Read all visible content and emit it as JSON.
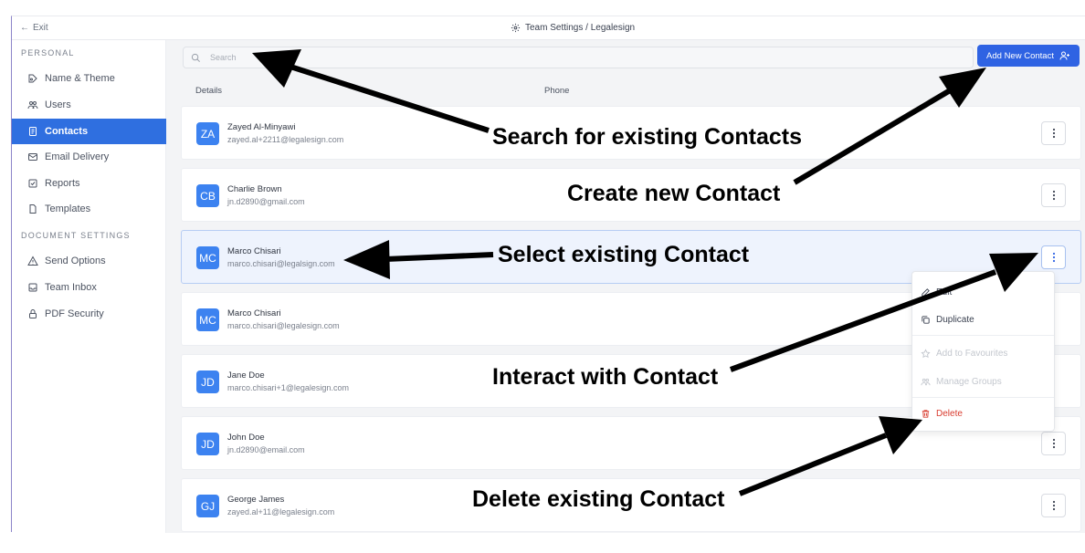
{
  "topbar": {
    "exit_label": "Exit",
    "title": "Team Settings / Legalesign"
  },
  "sidebar": {
    "personal_title": "PERSONAL",
    "document_title": "DOCUMENT SETTINGS",
    "items": [
      {
        "label": "Name & Theme",
        "icon": "brush-icon"
      },
      {
        "label": "Users",
        "icon": "users-icon"
      },
      {
        "label": "Contacts",
        "icon": "contacts-icon",
        "active": true
      },
      {
        "label": "Email Delivery",
        "icon": "mail-icon"
      },
      {
        "label": "Reports",
        "icon": "reports-icon"
      },
      {
        "label": "Templates",
        "icon": "document-icon"
      },
      {
        "label": "Send Options",
        "icon": "warning-icon"
      },
      {
        "label": "Team Inbox",
        "icon": "inbox-icon"
      },
      {
        "label": "PDF Security",
        "icon": "lock-icon"
      }
    ]
  },
  "search": {
    "placeholder": "Search",
    "value": ""
  },
  "add_button": {
    "label": "Add New Contact"
  },
  "columns": {
    "details": "Details",
    "phone": "Phone"
  },
  "contacts": [
    {
      "initials": "ZA",
      "name": "Zayed Al-Minyawi",
      "email": "zayed.al+2211@legalesign.com"
    },
    {
      "initials": "CB",
      "name": "Charlie Brown",
      "email": "jn.d2890@gmail.com"
    },
    {
      "initials": "MC",
      "name": "Marco Chisari",
      "email": "marco.chisari@legalsign.com",
      "selected": true
    },
    {
      "initials": "MC",
      "name": "Marco Chisari",
      "email": "marco.chisari@legalesign.com"
    },
    {
      "initials": "JD",
      "name": "Jane Doe",
      "email": "marco.chisari+1@legalesign.com"
    },
    {
      "initials": "JD",
      "name": "John Doe",
      "email": "jn.d2890@email.com"
    },
    {
      "initials": "GJ",
      "name": "George James",
      "email": "zayed.al+11@legalesign.com"
    }
  ],
  "context_menu": {
    "edit": "Edit",
    "duplicate": "Duplicate",
    "favourites": "Add to Favourites",
    "groups": "Manage Groups",
    "delete": "Delete"
  },
  "annotations": {
    "search": "Search for existing Contacts",
    "create": "Create new Contact",
    "select": "Select existing Contact",
    "interact": "Interact with Contact",
    "delete": "Delete existing Contact"
  },
  "colors": {
    "accent": "#2f63e3",
    "avatar": "#3c82f0",
    "danger": "#d83a2d",
    "sidebar_active": "#2f6fe0"
  }
}
